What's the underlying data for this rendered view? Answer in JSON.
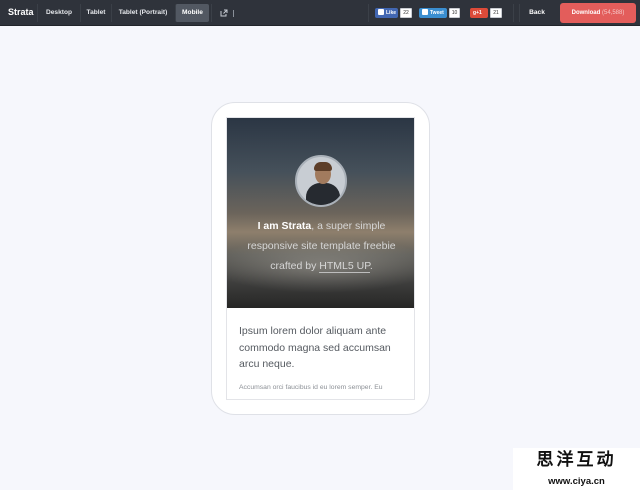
{
  "topbar": {
    "brand": "Strata",
    "nav": [
      "Desktop",
      "Tablet",
      "Tablet (Portrait)",
      "Mobile"
    ],
    "active_nav": "Mobile",
    "social": {
      "like_label": "Like",
      "like_count": "22",
      "tweet_label": "Tweet",
      "tweet_count": "10",
      "plus_label": "+1",
      "plus_count": "21"
    },
    "back_label": "Back",
    "download_label": "Download",
    "download_count": "(54,588)"
  },
  "preview": {
    "hero_strong": "I am Strata",
    "hero_mid": ", a super simple responsive site template freebie crafted by ",
    "hero_link": "HTML5 UP",
    "hero_end": ".",
    "lead": "Ipsum lorem dolor aliquam ante commodo magna sed accumsan arcu neque.",
    "small": "Accumsan orci faucibus id eu lorem semper. Eu"
  },
  "watermark": {
    "line1": "思洋互动",
    "line2": "www.ciya.cn"
  }
}
